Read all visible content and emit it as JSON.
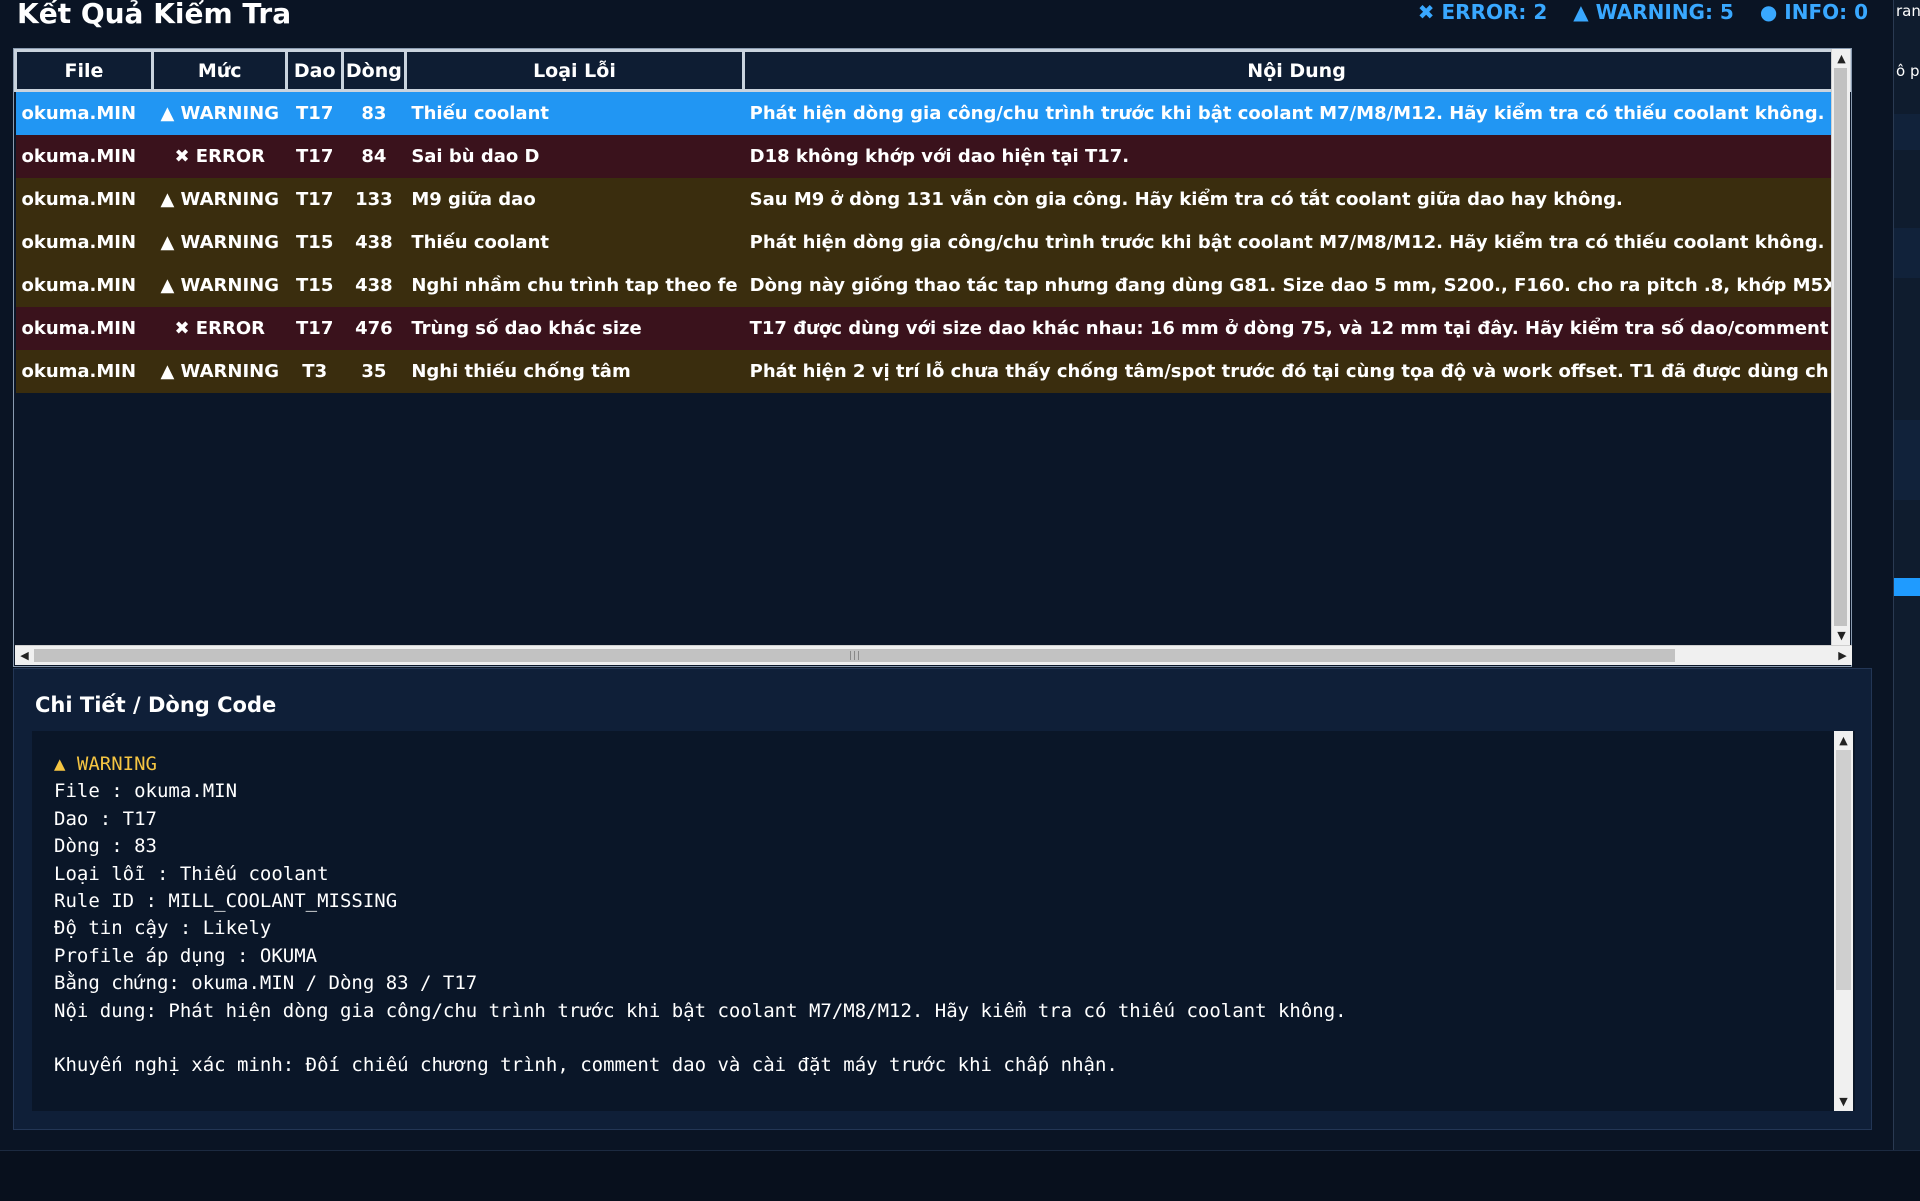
{
  "window": {
    "title": "Kết Quả Kiểm Tra"
  },
  "summary": {
    "error_label": "✖ ERROR: 2",
    "warning_label": "▲ WARNING: 5",
    "info_label": "● INFO: 0"
  },
  "table": {
    "columns": [
      "File",
      "Mức",
      "Dao",
      "Dòng",
      "Loại Lỗi",
      "Nội Dung"
    ],
    "rows": [
      {
        "file": "okuma.MIN",
        "level": "▲ WARNING",
        "tool": "T17",
        "line": "83",
        "type": "Thiếu coolant",
        "content": "Phát hiện dòng gia công/chu trình trước khi bật coolant M7/M8/M12. Hãy kiểm tra có thiếu coolant không."
      },
      {
        "file": "okuma.MIN",
        "level": "✖ ERROR",
        "tool": "T17",
        "line": "84",
        "type": "Sai bù dao D",
        "content": "D18 không khớp với dao hiện tại T17."
      },
      {
        "file": "okuma.MIN",
        "level": "▲ WARNING",
        "tool": "T17",
        "line": "133",
        "type": "M9 giữa dao",
        "content": "Sau M9 ở dòng 131 vẫn còn gia công. Hãy kiểm tra có tắt coolant giữa dao hay không."
      },
      {
        "file": "okuma.MIN",
        "level": "▲ WARNING",
        "tool": "T15",
        "line": "438",
        "type": "Thiếu coolant",
        "content": "Phát hiện dòng gia công/chu trình trước khi bật coolant M7/M8/M12. Hãy kiểm tra có thiếu coolant không."
      },
      {
        "file": "okuma.MIN",
        "level": "▲ WARNING",
        "tool": "T15",
        "line": "438",
        "type": "Nghi nhầm chu trình tap theo fe",
        "content": "Dòng này giống thao tác tap nhưng đang dùng G81. Size dao 5 mm, S200., F160. cho ra pitch .8, khớp M5X"
      },
      {
        "file": "okuma.MIN",
        "level": "✖ ERROR",
        "tool": "T17",
        "line": "476",
        "type": "Trùng số dao khác size",
        "content": "T17 được dùng với size dao khác nhau: 16 mm ở dòng 75, và 12 mm tại đây. Hãy kiểm tra số dao/comment"
      },
      {
        "file": "okuma.MIN",
        "level": "▲ WARNING",
        "tool": "T3",
        "line": "35",
        "type": "Nghi thiếu chống tâm",
        "content": "Phát hiện 2 vị trí lỗ chưa thấy chống tâm/spot trước đó tại cùng tọa độ và work offset. T1 đã được dùng ch"
      }
    ]
  },
  "detail": {
    "title": "Chi Tiết / Dòng Code",
    "level": "▲ WARNING",
    "file": "File : okuma.MIN",
    "tool": "Dao : T17",
    "line": "Dòng : 83",
    "type": "Loại lỗi : Thiếu coolant",
    "rule": "Rule ID : MILL_COOLANT_MISSING",
    "confidence": "Độ tin cậy : Likely",
    "profile": "Profile áp dụng : OKUMA",
    "evidence": "Bằng chứng: okuma.MIN / Dòng 83 / T17",
    "content": "Nội dung: Phát hiện dòng gia công/chu trình trước khi bật coolant M7/M8/M12. Hãy kiểm tra có thiếu coolant không.",
    "recommendation": "Khuyến nghị xác minh: Đối chiếu chương trình, comment dao và cài đặt máy trước khi chấp nhận."
  },
  "right_strip": {
    "text1": "ran",
    "text2": "ô pl"
  },
  "colors": {
    "selected_row": "#2196f3",
    "error_row": "#3a121c",
    "warning_row": "#3a2d0e",
    "summary_accent": "#39a8ff",
    "warning_text": "#f5c542"
  }
}
